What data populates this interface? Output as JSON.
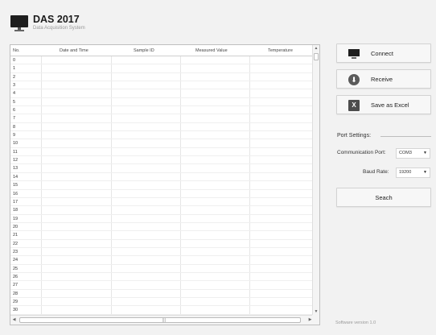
{
  "header": {
    "title": "DAS 2017",
    "subtitle": "Data Acquisition System",
    "icon": "monitor-icon"
  },
  "table": {
    "columns": [
      "No.",
      "Date and Time",
      "Sample ID",
      "Measured Value",
      "Temperature"
    ],
    "rows": [
      "0",
      "1",
      "2",
      "3",
      "4",
      "5",
      "6",
      "7",
      "8",
      "9",
      "10",
      "11",
      "12",
      "13",
      "14",
      "15",
      "16",
      "17",
      "18",
      "19",
      "20",
      "21",
      "22",
      "23",
      "24",
      "25",
      "26",
      "27",
      "28",
      "29",
      "30"
    ]
  },
  "buttons": {
    "connect": "Connect",
    "receive": "Receive",
    "excel": "Save as Excel",
    "search": "Seach"
  },
  "icons": {
    "connect": "monitor-icon",
    "receive": "download-circle-icon",
    "excel": "excel-icon"
  },
  "port": {
    "section_label": "Port Settings:",
    "comm_label": "Communication Port:",
    "comm_value": "COM3",
    "baud_label": "Baud Rate:",
    "baud_value": "19200"
  },
  "footer": {
    "version": "Software version 1.0"
  }
}
